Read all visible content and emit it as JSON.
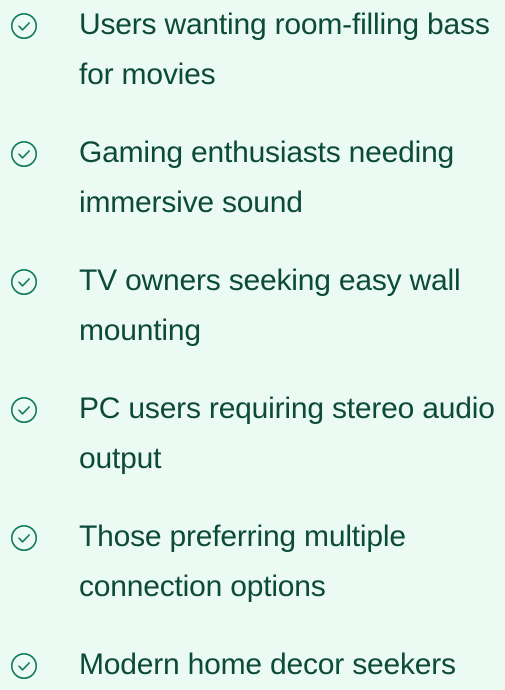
{
  "colors": {
    "background": "#ebfaf2",
    "text": "#0c4a3a",
    "icon": "#0f7a5a"
  },
  "features": [
    {
      "icon": "check-circle-icon",
      "text": "Users wanting room-filling bass for movies"
    },
    {
      "icon": "check-circle-icon",
      "text": "Gaming enthusiasts needing immersive sound"
    },
    {
      "icon": "check-circle-icon",
      "text": "TV owners seeking easy wall mounting"
    },
    {
      "icon": "check-circle-icon",
      "text": "PC users requiring stereo audio output"
    },
    {
      "icon": "check-circle-icon",
      "text": "Those preferring multiple connection options"
    },
    {
      "icon": "check-circle-icon",
      "text": "Modern home decor seekers"
    }
  ]
}
